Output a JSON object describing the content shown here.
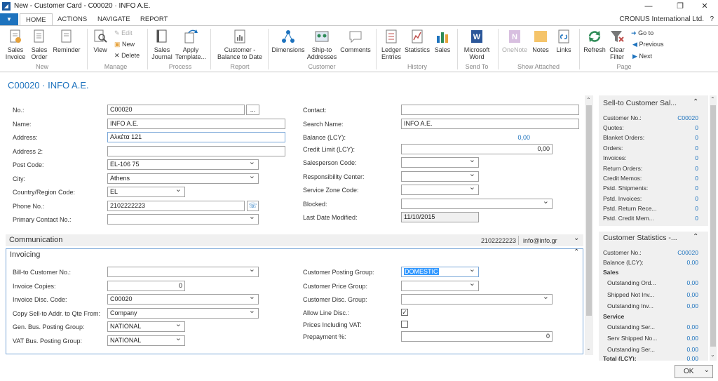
{
  "window": {
    "title": "New - Customer Card - C00020 · INFO A.E.",
    "minimize": "—",
    "restore": "❐",
    "close": "✕"
  },
  "ribbon_tabs": [
    "HOME",
    "ACTIONS",
    "NAVIGATE",
    "REPORT"
  ],
  "company": "CRONUS International Ltd.",
  "help": "?",
  "ribbon": {
    "sales_invoice": [
      "Sales",
      "Invoice"
    ],
    "sales_order": [
      "Sales",
      "Order"
    ],
    "reminder": "Reminder",
    "view": "View",
    "edit": "Edit",
    "new": "New",
    "delete": "Delete",
    "sales_journal": [
      "Sales",
      "Journal"
    ],
    "apply_template": [
      "Apply",
      "Template..."
    ],
    "customer_balance": [
      "Customer -",
      "Balance to Date"
    ],
    "dimensions": "Dimensions",
    "ship_to": [
      "Ship-to",
      "Addresses"
    ],
    "comments": "Comments",
    "ledger_entries": [
      "Ledger",
      "Entries"
    ],
    "statistics": "Statistics",
    "sales": "Sales",
    "word": [
      "Microsoft",
      "Word"
    ],
    "onenote": "OneNote",
    "notes": "Notes",
    "links": "Links",
    "refresh": "Refresh",
    "clear_filter": [
      "Clear",
      "Filter"
    ],
    "go_to": "Go to",
    "previous": "Previous",
    "next": "Next",
    "groups": {
      "new": "New",
      "manage": "Manage",
      "process": "Process",
      "report": "Report",
      "customer": "Customer",
      "history": "History",
      "send_to": "Send To",
      "show_attached": "Show Attached",
      "page": "Page"
    }
  },
  "page_title": "C00020 · INFO A.E.",
  "general": {
    "no_label": "No.:",
    "no_value": "C00020",
    "assist": "...",
    "name_label": "Name:",
    "name_value": "INFO A.E.",
    "address_label": "Address:",
    "address_value": "Αλκέτα 121",
    "address2_label": "Address 2:",
    "address2_value": "",
    "post_code_label": "Post Code:",
    "post_code_value": "EL-106 75",
    "city_label": "City:",
    "city_value": "Athens",
    "country_label": "Country/Region Code:",
    "country_value": "EL",
    "phone_label": "Phone No.:",
    "phone_value": "2102222223",
    "primary_contact_label": "Primary Contact No.:",
    "primary_contact_value": "",
    "contact_label": "Contact:",
    "contact_value": "",
    "search_name_label": "Search Name:",
    "search_name_value": "INFO A.E.",
    "balance_label": "Balance (LCY):",
    "balance_value": "0,00",
    "credit_limit_label": "Credit Limit (LCY):",
    "credit_limit_value": "0,00",
    "salesperson_label": "Salesperson Code:",
    "salesperson_value": "",
    "resp_center_label": "Responsibility Center:",
    "resp_center_value": "",
    "service_zone_label": "Service Zone Code:",
    "service_zone_value": "",
    "blocked_label": "Blocked:",
    "blocked_value": "",
    "last_modified_label": "Last Date Modified:",
    "last_modified_value": "11/10/2015"
  },
  "communication": {
    "title": "Communication",
    "phone": "2102222223",
    "email": "info@info.gr"
  },
  "invoicing": {
    "title": "Invoicing",
    "bill_to_label": "Bill-to Customer No.:",
    "bill_to_value": "",
    "invoice_copies_label": "Invoice Copies:",
    "invoice_copies_value": "0",
    "invoice_disc_label": "Invoice Disc. Code:",
    "invoice_disc_value": "C00020",
    "copy_sell_to_label": "Copy Sell-to Addr. to Qte From:",
    "copy_sell_to_value": "Company",
    "gen_bus_label": "Gen. Bus. Posting Group:",
    "gen_bus_value": "NATIONAL",
    "vat_bus_label": "VAT Bus. Posting Group:",
    "vat_bus_value": "NATIONAL",
    "cust_posting_label": "Customer Posting Group:",
    "cust_posting_value": "DOMESTIC",
    "cust_price_label": "Customer Price Group:",
    "cust_price_value": "",
    "cust_disc_label": "Customer Disc. Group:",
    "cust_disc_value": "",
    "allow_line_disc_label": "Allow Line Disc.:",
    "allow_line_disc_mark": "✓",
    "prices_incl_vat_label": "Prices Including VAT:",
    "prices_incl_vat_mark": "",
    "prepayment_label": "Prepayment %:",
    "prepayment_value": "0"
  },
  "factbox": {
    "sell_to": {
      "title": "Sell-to Customer Sal...",
      "rows": [
        {
          "label": "Customer No.:",
          "value": "C00020"
        },
        {
          "label": "Quotes:",
          "value": "0"
        },
        {
          "label": "Blanket Orders:",
          "value": "0"
        },
        {
          "label": "Orders:",
          "value": "0"
        },
        {
          "label": "Invoices:",
          "value": "0"
        },
        {
          "label": "Return Orders:",
          "value": "0"
        },
        {
          "label": "Credit Memos:",
          "value": "0"
        },
        {
          "label": "Pstd. Shipments:",
          "value": "0"
        },
        {
          "label": "Pstd. Invoices:",
          "value": "0"
        },
        {
          "label": "Pstd. Return Rece...",
          "value": "0"
        },
        {
          "label": "Pstd. Credit Mem...",
          "value": "0"
        }
      ]
    },
    "stats": {
      "title": "Customer Statistics -...",
      "customer_no_label": "Customer No.:",
      "customer_no_value": "C00020",
      "balance_label": "Balance (LCY):",
      "balance_value": "0,00",
      "sales_heading": "Sales",
      "sales_rows": [
        {
          "label": "Outstanding Ord...",
          "value": "0,00"
        },
        {
          "label": "Shipped Not Inv...",
          "value": "0,00"
        },
        {
          "label": "Outstanding Inv...",
          "value": "0,00"
        }
      ],
      "service_heading": "Service",
      "service_rows": [
        {
          "label": "Outstanding Ser...",
          "value": "0,00"
        },
        {
          "label": "Serv Shipped No...",
          "value": "0,00"
        },
        {
          "label": "Outstanding Ser...",
          "value": "0,00"
        }
      ],
      "total_label": "Total (LCY):",
      "total_value": "0,00"
    }
  },
  "ok_button": "OK"
}
